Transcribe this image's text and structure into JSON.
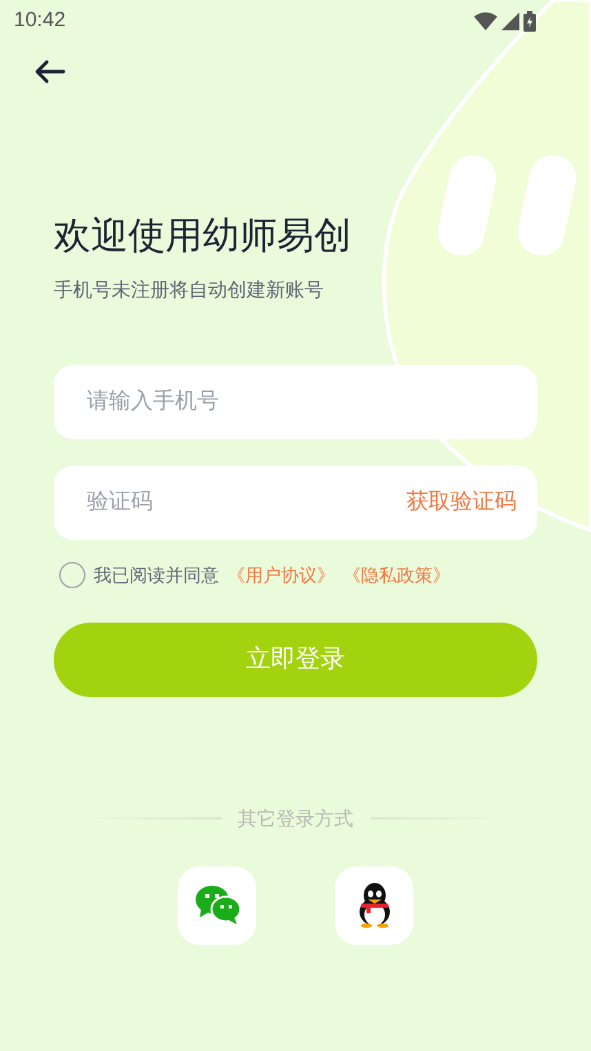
{
  "status_bar": {
    "time": "10:42"
  },
  "title": "欢迎使用幼师易创",
  "subtitle": "手机号未注册将自动创建新账号",
  "phone_field": {
    "placeholder": "请输入手机号"
  },
  "code_field": {
    "placeholder": "验证码",
    "action": "获取验证码"
  },
  "agreement": {
    "checked": false,
    "text": "我已阅读并同意",
    "links": [
      "《用户协议》",
      "《隐私政策》"
    ]
  },
  "login_button": "立即登录",
  "other_login": {
    "label": "其它登录方式",
    "options": [
      {
        "kind": "wechat"
      },
      {
        "kind": "qq"
      }
    ]
  }
}
